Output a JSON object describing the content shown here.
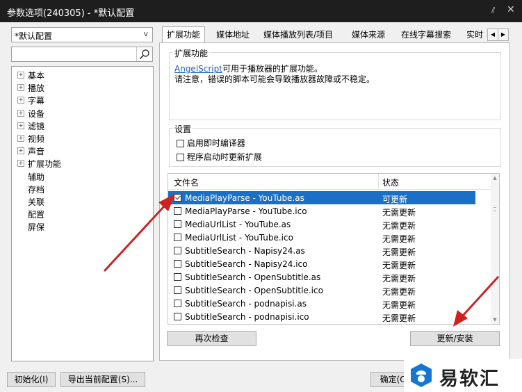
{
  "window": {
    "title": "参数选项(240305) - *默认配置"
  },
  "sidebar": {
    "preset_value": "*默认配置",
    "search_value": "",
    "tree": [
      {
        "label": "基本",
        "expandable": true
      },
      {
        "label": "播放",
        "expandable": true
      },
      {
        "label": "字幕",
        "expandable": true
      },
      {
        "label": "设备",
        "expandable": true
      },
      {
        "label": "滤镜",
        "expandable": true
      },
      {
        "label": "视频",
        "expandable": true
      },
      {
        "label": "声音",
        "expandable": true
      },
      {
        "label": "扩展功能",
        "expandable": true,
        "selected": true
      },
      {
        "label": "辅助",
        "expandable": false
      },
      {
        "label": "存档",
        "expandable": false
      },
      {
        "label": "关联",
        "expandable": false
      },
      {
        "label": "配置",
        "expandable": false
      },
      {
        "label": "屏保",
        "expandable": false
      }
    ]
  },
  "tabs": [
    "扩展功能",
    "媒体地址",
    "媒体播放列表/项目",
    "媒体来源",
    "在线字幕搜索",
    "实时"
  ],
  "extension": {
    "group_title": "扩展功能",
    "link_text": "AngelScript",
    "line1_rest": "可用于播放器的扩展功能。",
    "line2": "请注意，错误的脚本可能会导致播放器故障或不稳定。"
  },
  "settings": {
    "group_title": "设置",
    "options": [
      "启用即时编译器",
      "程序启动时更新扩展"
    ]
  },
  "file_list": {
    "col_name": "文件名",
    "col_status": "状态",
    "rows": [
      {
        "name": "MediaPlayParse - YouTube.as",
        "status": "可更新",
        "checked": true,
        "selected": true
      },
      {
        "name": "MediaPlayParse - YouTube.ico",
        "status": "无需更新",
        "checked": false
      },
      {
        "name": "MediaUrlList - YouTube.as",
        "status": "无需更新",
        "checked": false
      },
      {
        "name": "MediaUrlList - YouTube.ico",
        "status": "无需更新",
        "checked": false
      },
      {
        "name": "SubtitleSearch - Napisy24.as",
        "status": "无需更新",
        "checked": false
      },
      {
        "name": "SubtitleSearch - Napisy24.ico",
        "status": "无需更新",
        "checked": false
      },
      {
        "name": "SubtitleSearch - OpenSubtitle.as",
        "status": "无需更新",
        "checked": false
      },
      {
        "name": "SubtitleSearch - OpenSubtitle.ico",
        "status": "无需更新",
        "checked": false
      },
      {
        "name": "SubtitleSearch - podnapisi.as",
        "status": "无需更新",
        "checked": false
      },
      {
        "name": "SubtitleSearch - podnapisi.ico",
        "status": "无需更新",
        "checked": false
      }
    ]
  },
  "buttons": {
    "recheck": "再次检查",
    "update_install": "更新/安装",
    "init": "初始化(I)",
    "export": "导出当前配置(S)...",
    "ok": "确定(O)"
  },
  "watermark": {
    "text": "易软汇"
  },
  "colors": {
    "selection": "#1a6fc6",
    "annotation_arrow": "#cc2222",
    "titlebar": "#1e1e1e"
  }
}
